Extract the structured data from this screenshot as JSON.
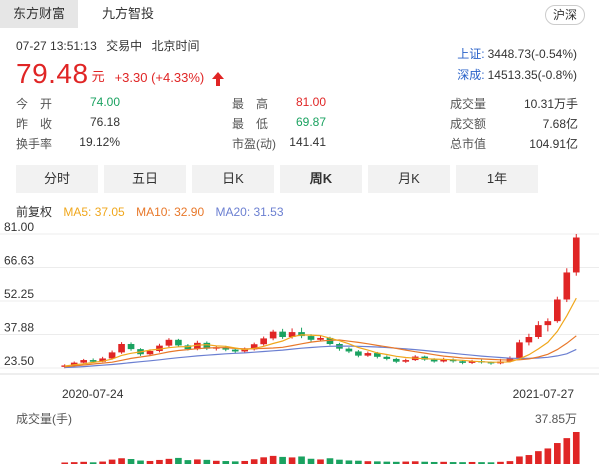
{
  "tabs": [
    {
      "label": "东方财富",
      "active": true
    },
    {
      "label": "九方智投",
      "active": false
    }
  ],
  "market_button": "沪深",
  "meta": {
    "datetime": "07-27 13:51:13",
    "status": "交易中",
    "timezone": "北京时间"
  },
  "quote": {
    "price": "79.48",
    "unit": "元",
    "change": "+3.30 (+4.33%)",
    "direction": "up"
  },
  "indices": [
    {
      "name": "上证:",
      "value": "3448.73(-0.54%)"
    },
    {
      "name": "深成:",
      "value": "14513.35(-0.8%)"
    }
  ],
  "stats": [
    [
      {
        "label": "今　开",
        "value": "74.00",
        "color": "green"
      },
      {
        "label": "最　高",
        "value": "81.00",
        "color": "red"
      },
      {
        "label": "成交量",
        "value": "10.31万手",
        "color": "dark"
      }
    ],
    [
      {
        "label": "昨　收",
        "value": "76.18",
        "color": "dark"
      },
      {
        "label": "最　低",
        "value": "69.87",
        "color": "green"
      },
      {
        "label": "成交额",
        "value": "7.68亿",
        "color": "dark"
      }
    ],
    [
      {
        "label": "换手率",
        "value": "19.12%",
        "color": "dark"
      },
      {
        "label": "市盈(动)",
        "value": "141.41",
        "color": "dark"
      },
      {
        "label": "总市值",
        "value": "104.91亿",
        "color": "dark"
      }
    ]
  ],
  "period_tabs": [
    {
      "label": "分时",
      "active": false
    },
    {
      "label": "五日",
      "active": false
    },
    {
      "label": "日K",
      "active": false
    },
    {
      "label": "周K",
      "active": true
    },
    {
      "label": "月K",
      "active": false
    },
    {
      "label": "1年",
      "active": false
    }
  ],
  "ma_legend": {
    "adjust": "前复权",
    "items": [
      {
        "label": "MA5: 37.05",
        "color": "#f0a71c"
      },
      {
        "label": "MA10: 32.90",
        "color": "#e8782a"
      },
      {
        "label": "MA20: 31.53",
        "color": "#6b7fd1"
      }
    ]
  },
  "colors": {
    "up": "#e02525",
    "down": "#1aa260",
    "grid": "#ececec"
  },
  "chart_data": {
    "type": "candlestick",
    "y_ticks": [
      "81.00",
      "66.63",
      "52.25",
      "37.88",
      "23.50"
    ],
    "ylim": [
      23.5,
      81.0
    ],
    "x_labels": [
      "2020-07-24",
      "2021-07-27"
    ],
    "candles": [
      [
        24.0,
        24.6,
        23.4,
        25.1
      ],
      [
        24.6,
        25.8,
        24.2,
        26.3
      ],
      [
        25.8,
        26.9,
        25.5,
        27.4
      ],
      [
        26.9,
        26.2,
        25.7,
        27.6
      ],
      [
        26.2,
        27.6,
        26.0,
        28.3
      ],
      [
        27.6,
        30.2,
        27.1,
        31.0
      ],
      [
        30.2,
        33.8,
        29.6,
        34.6
      ],
      [
        33.8,
        31.6,
        30.9,
        34.5
      ],
      [
        31.6,
        29.4,
        28.7,
        32.0
      ],
      [
        29.4,
        30.8,
        28.9,
        31.5
      ],
      [
        30.8,
        33.1,
        30.2,
        33.9
      ],
      [
        33.1,
        35.6,
        32.4,
        36.3
      ],
      [
        35.6,
        33.2,
        32.6,
        36.0
      ],
      [
        33.2,
        31.6,
        31.0,
        33.8
      ],
      [
        31.6,
        34.3,
        31.1,
        35.2
      ],
      [
        34.3,
        31.8,
        31.2,
        34.9
      ],
      [
        31.8,
        32.4,
        31.0,
        33.1
      ],
      [
        32.4,
        31.4,
        30.7,
        33.0
      ],
      [
        31.4,
        30.6,
        29.9,
        32.0
      ],
      [
        30.6,
        31.5,
        29.8,
        32.3
      ],
      [
        31.5,
        33.7,
        31.0,
        34.4
      ],
      [
        33.7,
        36.2,
        33.1,
        37.0
      ],
      [
        36.2,
        39.1,
        35.4,
        39.9
      ],
      [
        39.1,
        36.8,
        36.0,
        40.3
      ],
      [
        36.8,
        38.9,
        36.1,
        40.5
      ],
      [
        38.9,
        37.2,
        36.3,
        40.8
      ],
      [
        37.2,
        35.6,
        34.8,
        38.0
      ],
      [
        35.6,
        36.4,
        34.9,
        37.3
      ],
      [
        36.4,
        33.8,
        33.2,
        36.9
      ],
      [
        33.8,
        31.8,
        30.9,
        34.3
      ],
      [
        31.8,
        30.6,
        29.9,
        32.4
      ],
      [
        30.6,
        28.8,
        28.1,
        31.2
      ],
      [
        28.8,
        29.9,
        28.3,
        30.6
      ],
      [
        29.9,
        28.3,
        27.6,
        30.4
      ],
      [
        28.3,
        27.4,
        26.8,
        28.9
      ],
      [
        27.4,
        26.2,
        25.6,
        27.9
      ],
      [
        26.2,
        26.9,
        25.7,
        27.5
      ],
      [
        26.9,
        28.4,
        26.5,
        29.0
      ],
      [
        28.4,
        27.1,
        26.6,
        28.8
      ],
      [
        27.1,
        26.3,
        25.8,
        27.7
      ],
      [
        26.3,
        27.2,
        25.9,
        27.9
      ],
      [
        27.2,
        26.4,
        25.8,
        27.6
      ],
      [
        26.4,
        25.7,
        25.1,
        26.9
      ],
      [
        25.7,
        26.4,
        25.2,
        27.0
      ],
      [
        26.4,
        25.9,
        25.4,
        27.1
      ],
      [
        25.9,
        25.5,
        24.9,
        26.3
      ],
      [
        25.5,
        26.3,
        25.1,
        27.4
      ],
      [
        26.3,
        27.8,
        25.9,
        28.5
      ],
      [
        27.8,
        34.5,
        27.2,
        35.6
      ],
      [
        34.5,
        36.8,
        33.2,
        38.2
      ],
      [
        36.8,
        41.9,
        36.0,
        43.6
      ],
      [
        41.9,
        43.6,
        39.2,
        44.8
      ],
      [
        43.6,
        52.9,
        42.9,
        54.1
      ],
      [
        52.9,
        64.5,
        51.8,
        66.3
      ],
      [
        64.5,
        79.5,
        63.1,
        81.0
      ]
    ],
    "ma5": [
      24.3,
      24.9,
      25.3,
      25.9,
      26.4,
      27.3,
      28.9,
      29.8,
      30.4,
      31.2,
      31.6,
      32.2,
      32.6,
      32.7,
      33.3,
      33.5,
      33.0,
      32.8,
      32.1,
      31.4,
      31.9,
      32.8,
      34.0,
      35.1,
      36.9,
      37.7,
      37.6,
      37.4,
      36.3,
      35.2,
      33.9,
      32.3,
      31.2,
      30.0,
      29.3,
      28.5,
      28.0,
      27.7,
      27.5,
      27.3,
      27.2,
      27.0,
      26.8,
      26.4,
      26.2,
      26.0,
      26.0,
      26.1,
      27.4,
      29.2,
      31.7,
      34.5,
      39.2,
      45.9,
      53.5
    ],
    "ma10": [
      24.0,
      24.4,
      24.8,
      25.2,
      25.6,
      26.0,
      26.8,
      27.6,
      28.2,
      28.8,
      29.6,
      30.4,
      31.0,
      31.4,
      31.8,
      32.1,
      32.2,
      32.2,
      31.9,
      31.7,
      31.8,
      31.9,
      32.1,
      32.4,
      33.1,
      33.9,
      34.6,
      35.1,
      35.4,
      35.5,
      35.0,
      34.5,
      33.9,
      33.2,
      32.6,
      31.9,
      31.2,
      30.5,
      29.9,
      29.2,
      28.6,
      28.2,
      27.8,
      27.6,
      27.4,
      27.2,
      27.0,
      26.9,
      27.0,
      27.4,
      28.2,
      29.4,
      31.4,
      34.1,
      37.3
    ],
    "ma20": [
      23.7,
      23.9,
      24.1,
      24.4,
      24.7,
      25.0,
      25.4,
      25.8,
      26.2,
      26.6,
      27.0,
      27.5,
      27.9,
      28.3,
      28.7,
      29.0,
      29.3,
      29.6,
      29.8,
      30.0,
      30.3,
      30.6,
      30.9,
      31.2,
      31.6,
      32.0,
      32.3,
      32.6,
      32.8,
      32.9,
      32.9,
      32.8,
      32.7,
      32.5,
      32.3,
      32.0,
      31.7,
      31.4,
      31.0,
      30.6,
      30.2,
      29.8,
      29.4,
      29.0,
      28.6,
      28.3,
      28.0,
      27.7,
      27.6,
      27.6,
      27.8,
      28.1,
      28.7,
      29.6,
      31.5
    ],
    "volume": [
      1.8,
      2.2,
      2.6,
      2.0,
      2.9,
      5.2,
      6.8,
      5.9,
      4.1,
      3.6,
      4.8,
      6.1,
      7.2,
      4.6,
      5.4,
      4.9,
      3.8,
      3.5,
      3.1,
      3.6,
      5.6,
      7.9,
      9.6,
      8.4,
      7.8,
      8.9,
      6.2,
      5.4,
      6.8,
      5.1,
      4.2,
      3.9,
      3.3,
      3.1,
      2.8,
      2.6,
      2.9,
      3.2,
      2.7,
      2.4,
      2.6,
      2.3,
      2.2,
      2.4,
      2.2,
      2.0,
      2.6,
      3.4,
      8.9,
      10.6,
      15.2,
      18.4,
      24.8,
      30.6,
      37.85
    ],
    "volume_title": "成交量(手)",
    "volume_max_label": "37.85万"
  }
}
